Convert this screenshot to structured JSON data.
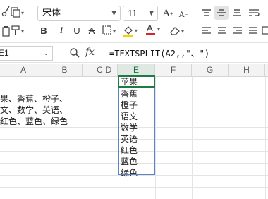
{
  "ribbon": {
    "font_name": "宋体",
    "font_size": "11",
    "grow_font_icon": "font-grow-icon",
    "shrink_font_icon": "font-shrink-icon",
    "bold": "B",
    "italic": "I",
    "underline": "U",
    "strikethrough": "A",
    "font_color_letter": "A",
    "font_color_accent": "#d9242b",
    "highlight_accent": "#f5d200",
    "clipboard_icons": [
      "cut-icon",
      "copy-icon",
      "paste-icon",
      "format-painter-icon"
    ]
  },
  "formula_bar": {
    "name_box": "E1",
    "fx_label": "fx",
    "formula": "=TEXTSPLIT(A2,,\"、\")"
  },
  "grid": {
    "columns": [
      "A",
      "B",
      "C",
      "D",
      "E",
      "F",
      "G",
      "H"
    ],
    "active_column": "E",
    "a_cell_lines": [
      "果、香蕉、橙子、",
      "文、数学、英语、",
      "红色、蓝色、绿色"
    ],
    "spill_values": [
      "苹果",
      "香蕉",
      "橙子",
      "语文",
      "数学",
      "英语",
      "红色",
      "蓝色",
      "绿色"
    ],
    "accent_green": "#1e7b43",
    "spill_border": "#5b86c5"
  }
}
